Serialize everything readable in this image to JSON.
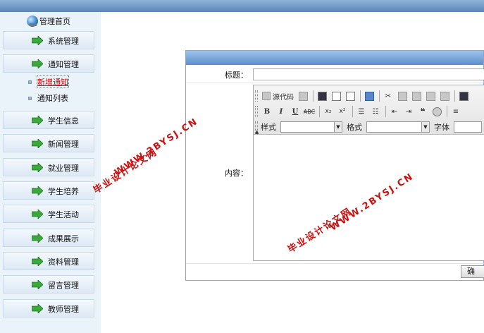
{
  "sidebar": {
    "home_label": "管理首页",
    "items": [
      {
        "label": "系统管理"
      },
      {
        "label": "通知管理"
      },
      {
        "label": "学生信息"
      },
      {
        "label": "新闻管理"
      },
      {
        "label": "就业管理"
      },
      {
        "label": "学生培养"
      },
      {
        "label": "学生活动"
      },
      {
        "label": "成果展示"
      },
      {
        "label": "资料管理"
      },
      {
        "label": "留言管理"
      },
      {
        "label": "教师管理"
      }
    ],
    "sub_items": [
      {
        "label": "新增通知",
        "active": true
      },
      {
        "label": "通知列表",
        "active": false
      }
    ]
  },
  "form": {
    "title_label": "标题：",
    "title_value": "",
    "content_label": "内容：",
    "submit_label": "确"
  },
  "editor": {
    "source_label": "源代码",
    "style_label": "样式",
    "format_label": "格式",
    "font_label": "字体",
    "style_value": "",
    "format_value": "",
    "font_value": ""
  },
  "watermark": {
    "line1": "WWW.2BYSJ.CN",
    "line2": "毕业设计论文网"
  },
  "colors": {
    "accent": "#5b8fcc",
    "sidebar_bg": "#eaf2fa",
    "active_sub": "#dd0000",
    "watermark": "#cc1111"
  }
}
